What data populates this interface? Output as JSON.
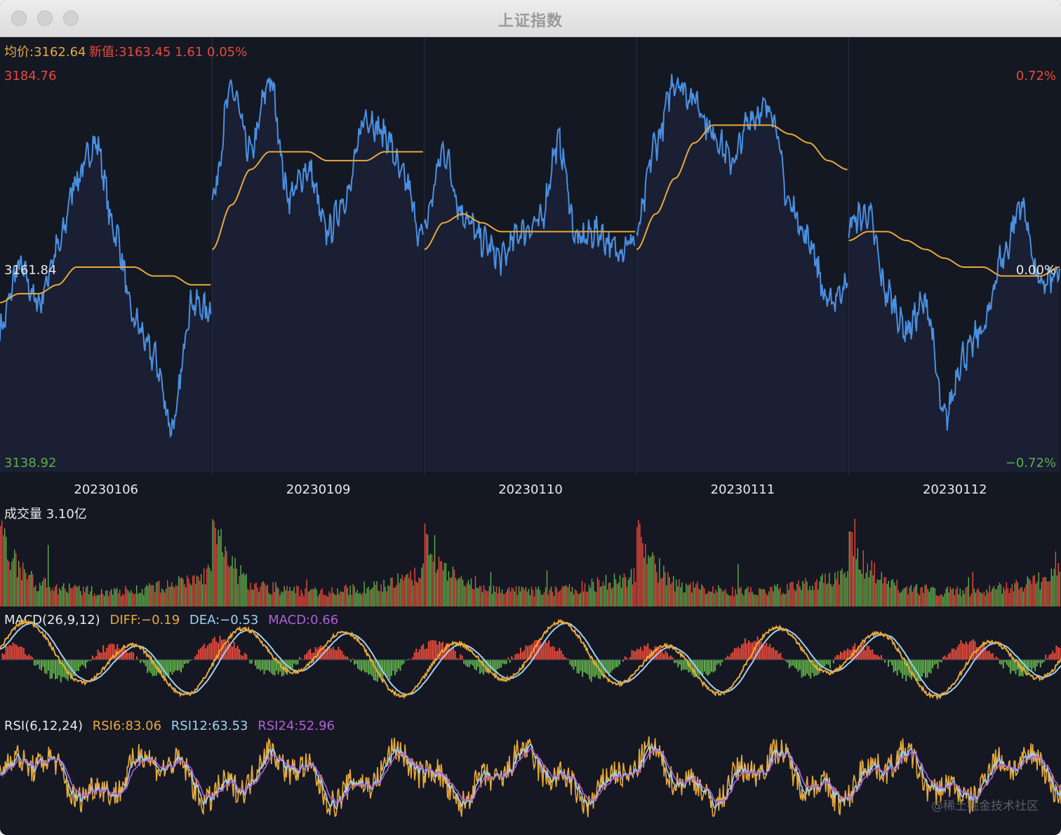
{
  "window": {
    "title": "上证指数"
  },
  "header": {
    "avg_label": "均价:3162.64",
    "new_label": "新值:3163.45 1.61 0.05%"
  },
  "price_axis": {
    "high": "3184.76",
    "mid": "3161.84",
    "low": "3138.92",
    "high_pct": "0.72%",
    "mid_pct": "0.00%",
    "low_pct": "−0.72%"
  },
  "colors": {
    "price_line": "#4a8fe0",
    "avg_line": "#e8a93a",
    "up": "#e84a3a",
    "down": "#5fae4a",
    "dea": "#9fd0f5",
    "rsi24": "#b05fd6",
    "panel_bg": "#1a2035"
  },
  "volume": {
    "label": "成交量  3.10亿"
  },
  "macd": {
    "name": "MACD(26,9,12)",
    "diff": "DIFF:−0.19",
    "dea": "DEA:−0.53",
    "macd": "MACD:0.66"
  },
  "rsi": {
    "name": "RSI(6,12,24)",
    "rsi6": "RSI6:83.06",
    "rsi12": "RSI12:63.53",
    "rsi24": "RSI24:52.96"
  },
  "watermark": "@稀土掘金技术社区",
  "chart_data": {
    "type": "line",
    "title": "上证指数",
    "days": [
      "20230106",
      "20230109",
      "20230110",
      "20230111",
      "20230112"
    ],
    "ylim": [
      3138.92,
      3184.76
    ],
    "pct_lim": [
      -0.72,
      0.72
    ],
    "prev_close": 3161.84,
    "series": [
      {
        "name": "price",
        "day_values": [
          [
            3155,
            3162,
            3158,
            3164,
            3172,
            3176,
            3166,
            3156,
            3152,
            3144,
            3158,
            3157
          ],
          [
            3170,
            3182,
            3175,
            3183,
            3170,
            3173,
            3166,
            3170,
            3179,
            3177,
            3172,
            3165
          ],
          [
            3167,
            3175,
            3168,
            3165,
            3163,
            3166,
            3167,
            3176,
            3165,
            3166,
            3164,
            3165
          ],
          [
            3166,
            3176,
            3183,
            3181,
            3177,
            3174,
            3179,
            3180,
            3169,
            3165,
            3158,
            3160
          ],
          [
            3167,
            3168,
            3159,
            3155,
            3158,
            3145,
            3152,
            3155,
            3163,
            3169,
            3160,
            3161
          ]
        ]
      },
      {
        "name": "average",
        "day_values": [
          [
            3158,
            3159,
            3159,
            3160,
            3162,
            3162,
            3162,
            3162,
            3161,
            3161,
            3160,
            3160
          ],
          [
            3164,
            3169,
            3173,
            3175,
            3175,
            3175,
            3174,
            3174,
            3174,
            3175,
            3175,
            3175
          ],
          [
            3164,
            3167,
            3168,
            3167,
            3166,
            3166,
            3166,
            3166,
            3166,
            3166,
            3166,
            3166
          ],
          [
            3164,
            3168,
            3172,
            3176,
            3178,
            3178,
            3178,
            3178,
            3177,
            3176,
            3174,
            3173
          ],
          [
            3165,
            3166,
            3166,
            3165,
            3164,
            3163,
            3162,
            3162,
            3161,
            3161,
            3161,
            3162
          ]
        ]
      }
    ],
    "volume_profile": [
      1.0,
      0.5,
      0.3,
      0.25,
      0.22,
      0.2,
      0.2,
      0.22,
      0.25,
      0.3,
      0.35,
      0.45
    ],
    "macd_zero_line": 0,
    "rsi_range": [
      0,
      100
    ]
  }
}
